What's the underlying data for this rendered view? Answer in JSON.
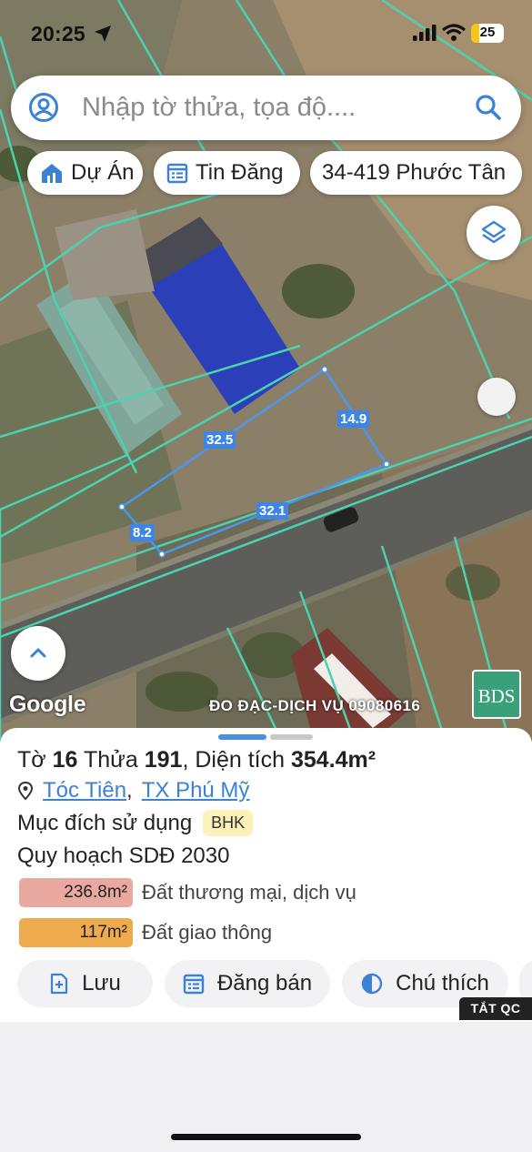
{
  "status_bar": {
    "time": "20:25",
    "battery": "25"
  },
  "search": {
    "placeholder": "Nhập tờ thửa, tọa độ...."
  },
  "chips": [
    {
      "label": "Dự Án",
      "icon": "home-chart-icon"
    },
    {
      "label": "Tin Đăng",
      "icon": "calendar-list-icon"
    },
    {
      "label": "34-419 Phước Tân"
    }
  ],
  "map": {
    "attribution": "Google",
    "watermark": "ĐO ĐẠC-DỊCH VỤ 09080616",
    "logo_text": "BDS",
    "dimensions": [
      "32.5",
      "14.9",
      "32.1",
      "8.2"
    ],
    "line_color": "#4ad3b0",
    "parcel_color": "#3e86e6"
  },
  "parcel": {
    "sheet_label": "Tờ",
    "sheet_no": "16",
    "parcel_label": "Thửa",
    "parcel_no": "191",
    "area_label": "Diện tích",
    "area_value": "354.4m²",
    "ward": "Tóc Tiên",
    "town": "TX Phú Mỹ",
    "purpose_label": "Mục đích sử dụng",
    "purpose_code": "BHK",
    "plan_label": "Quy hoạch SDĐ 2030",
    "zones": [
      {
        "area": "236.8m²",
        "label": "Đất thương mại, dịch vụ",
        "color": "#e9a8a0"
      },
      {
        "area": "117m²",
        "label": "Đất giao thông",
        "color": "#eeab4d"
      }
    ]
  },
  "actions": [
    {
      "label": "Lưu",
      "icon": "add-file-icon"
    },
    {
      "label": "Đăng bán",
      "icon": "calendar-list-icon"
    },
    {
      "label": "Chú thích",
      "icon": "contrast-icon"
    }
  ],
  "ad": {
    "close_label": "TẮT QC"
  }
}
